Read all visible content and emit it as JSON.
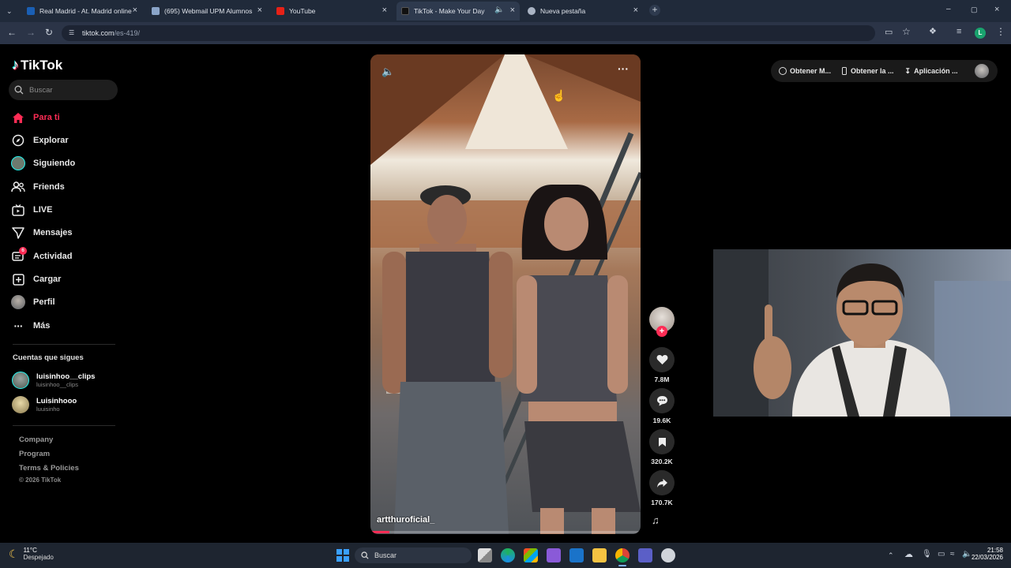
{
  "browser": {
    "tabs": [
      {
        "label": "Real Madrid - At. Madrid online",
        "fav_color": "#1a5fb4",
        "active": false
      },
      {
        "label": "(695) Webmail UPM Alumnos",
        "fav_color": "#8aa4c8",
        "active": false
      },
      {
        "label": "YouTube",
        "fav_color": "#e62117",
        "active": false
      },
      {
        "label": "TikTok - Make Your Day",
        "fav_color": "#111111",
        "active": true
      },
      {
        "label": "Nueva pestaña",
        "fav_color": "#aab4c4",
        "active": false
      }
    ],
    "address": {
      "host": "tiktok.com",
      "path": "/es-419/"
    },
    "profile_initial": "L"
  },
  "tiktok": {
    "logo": "TikTok",
    "search_placeholder": "Buscar",
    "nav": [
      {
        "label": "Para ti",
        "icon": "home-icon",
        "active": true
      },
      {
        "label": "Explorar",
        "icon": "compass-icon"
      },
      {
        "label": "Siguiendo",
        "icon": "following-avatar-icon"
      },
      {
        "label": "Friends",
        "icon": "friends-icon"
      },
      {
        "label": "LIVE",
        "icon": "live-icon"
      },
      {
        "label": "Mensajes",
        "icon": "messages-icon"
      },
      {
        "label": "Actividad",
        "icon": "activity-icon",
        "badge": "6"
      },
      {
        "label": "Cargar",
        "icon": "upload-icon"
      },
      {
        "label": "Perfil",
        "icon": "profile-avatar-icon"
      },
      {
        "label": "Más",
        "icon": "more-icon"
      }
    ],
    "following_heading": "Cuentas que sigues",
    "following": [
      {
        "name": "luisinhoo__clips",
        "handle": "luisinhoo__clips"
      },
      {
        "name": "Luisinhooo",
        "handle": "luuisinho"
      }
    ],
    "footer": [
      "Company",
      "Program",
      "Terms & Policies"
    ],
    "copyright": "© 2026 TikTok",
    "top_actions": [
      "Obtener M...",
      "Obtener la ...",
      "Aplicación ..."
    ],
    "video": {
      "author": "artthuroficial_",
      "likes": "7.8M",
      "comments": "19.6K",
      "saves": "320.2K",
      "shares": "170.7K"
    },
    "accent": "#fe2c55"
  },
  "taskbar": {
    "temp": "11°C",
    "weather": "Despejado",
    "search_placeholder": "Buscar",
    "time": "21:58",
    "date": "22/03/2026"
  }
}
